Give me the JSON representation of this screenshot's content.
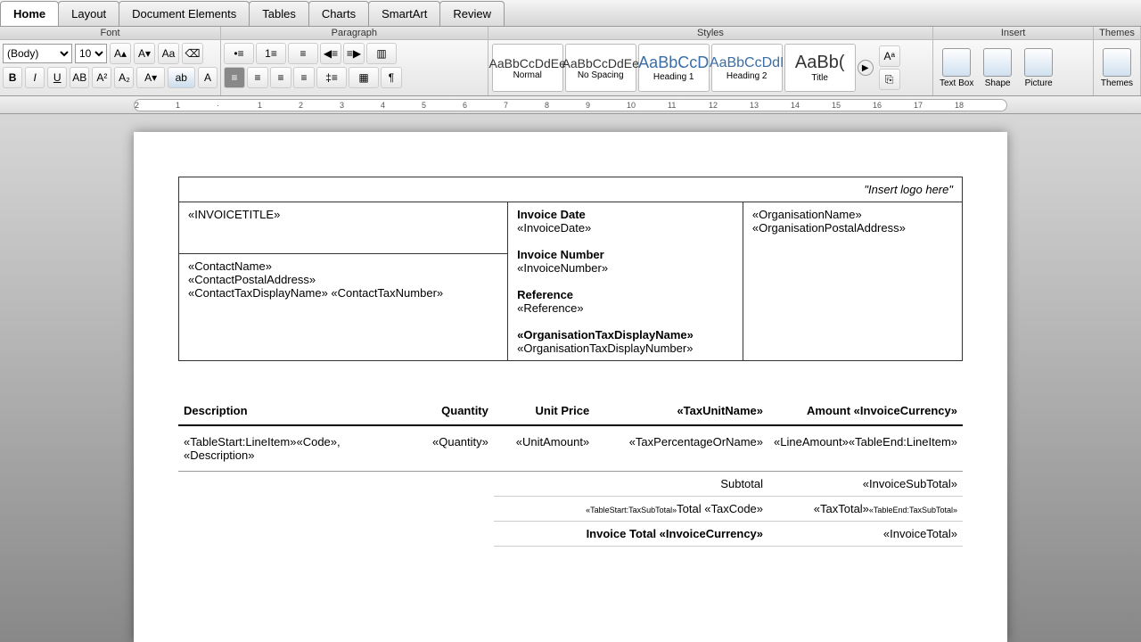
{
  "tabs": [
    "Home",
    "Layout",
    "Document Elements",
    "Tables",
    "Charts",
    "SmartArt",
    "Review"
  ],
  "groups": {
    "font": "Font",
    "paragraph": "Paragraph",
    "styles": "Styles",
    "insert": "Insert",
    "themes": "Themes"
  },
  "font": {
    "name": "(Body)",
    "size": "10"
  },
  "styles": {
    "normal": {
      "preview": "AaBbCcDdEe",
      "label": "Normal"
    },
    "nospacing": {
      "preview": "AaBbCcDdEe",
      "label": "No Spacing"
    },
    "h1": {
      "preview": "AaBbCcD",
      "label": "Heading 1"
    },
    "h2": {
      "preview": "AaBbCcDdI",
      "label": "Heading 2"
    },
    "title": {
      "preview": "AaBb(",
      "label": "Title"
    }
  },
  "insert": {
    "textbox": "Text Box",
    "shape": "Shape",
    "picture": "Picture",
    "themes": "Themes"
  },
  "ruler": [
    "2",
    "1",
    "·",
    "1",
    "2",
    "3",
    "4",
    "5",
    "6",
    "7",
    "8",
    "9",
    "10",
    "11",
    "12",
    "13",
    "14",
    "15",
    "16",
    "17",
    "18"
  ],
  "doc": {
    "logo_hint": "\"Insert logo here\"",
    "title": "«INVOICETITLE»",
    "invoice_date_label": "Invoice Date",
    "invoice_date": "«InvoiceDate»",
    "org_name": "«OrganisationName»",
    "org_addr": "«OrganisationPostalAddress»",
    "contact_name": "«ContactName»",
    "contact_addr": "«ContactPostalAddress»",
    "contact_tax": "«ContactTaxDisplayName» «ContactTaxNumber»",
    "invoice_number_label": "Invoice Number",
    "invoice_number": "«InvoiceNumber»",
    "reference_label": "Reference",
    "reference": "«Reference»",
    "org_tax_label": "«OrganisationTaxDisplayName»",
    "org_tax_num": "«OrganisationTaxDisplayNumber»",
    "cols": {
      "desc": "Description",
      "qty": "Quantity",
      "unit": "Unit Price",
      "tax": "«TaxUnitName»",
      "amount": "Amount «InvoiceCurrency»"
    },
    "row": {
      "desc": "«TableStart:LineItem»«Code», «Description»",
      "qty": "«Quantity»",
      "unit": "«UnitAmount»",
      "tax": "«TaxPercentageOrName»",
      "amount": "«LineAmount»«TableEnd:LineItem»"
    },
    "subtotal_label": "Subtotal",
    "subtotal": "«InvoiceSubTotal»",
    "taxsub_pre": "«TableStart:TaxSubTotal»",
    "taxsub_label": "Total «TaxCode»",
    "taxsub_val": "«TaxTotal»",
    "taxsub_post": "«TableEnd:TaxSubTotal»",
    "total_label": "Invoice Total «InvoiceCurrency»",
    "total": "«InvoiceTotal»"
  }
}
